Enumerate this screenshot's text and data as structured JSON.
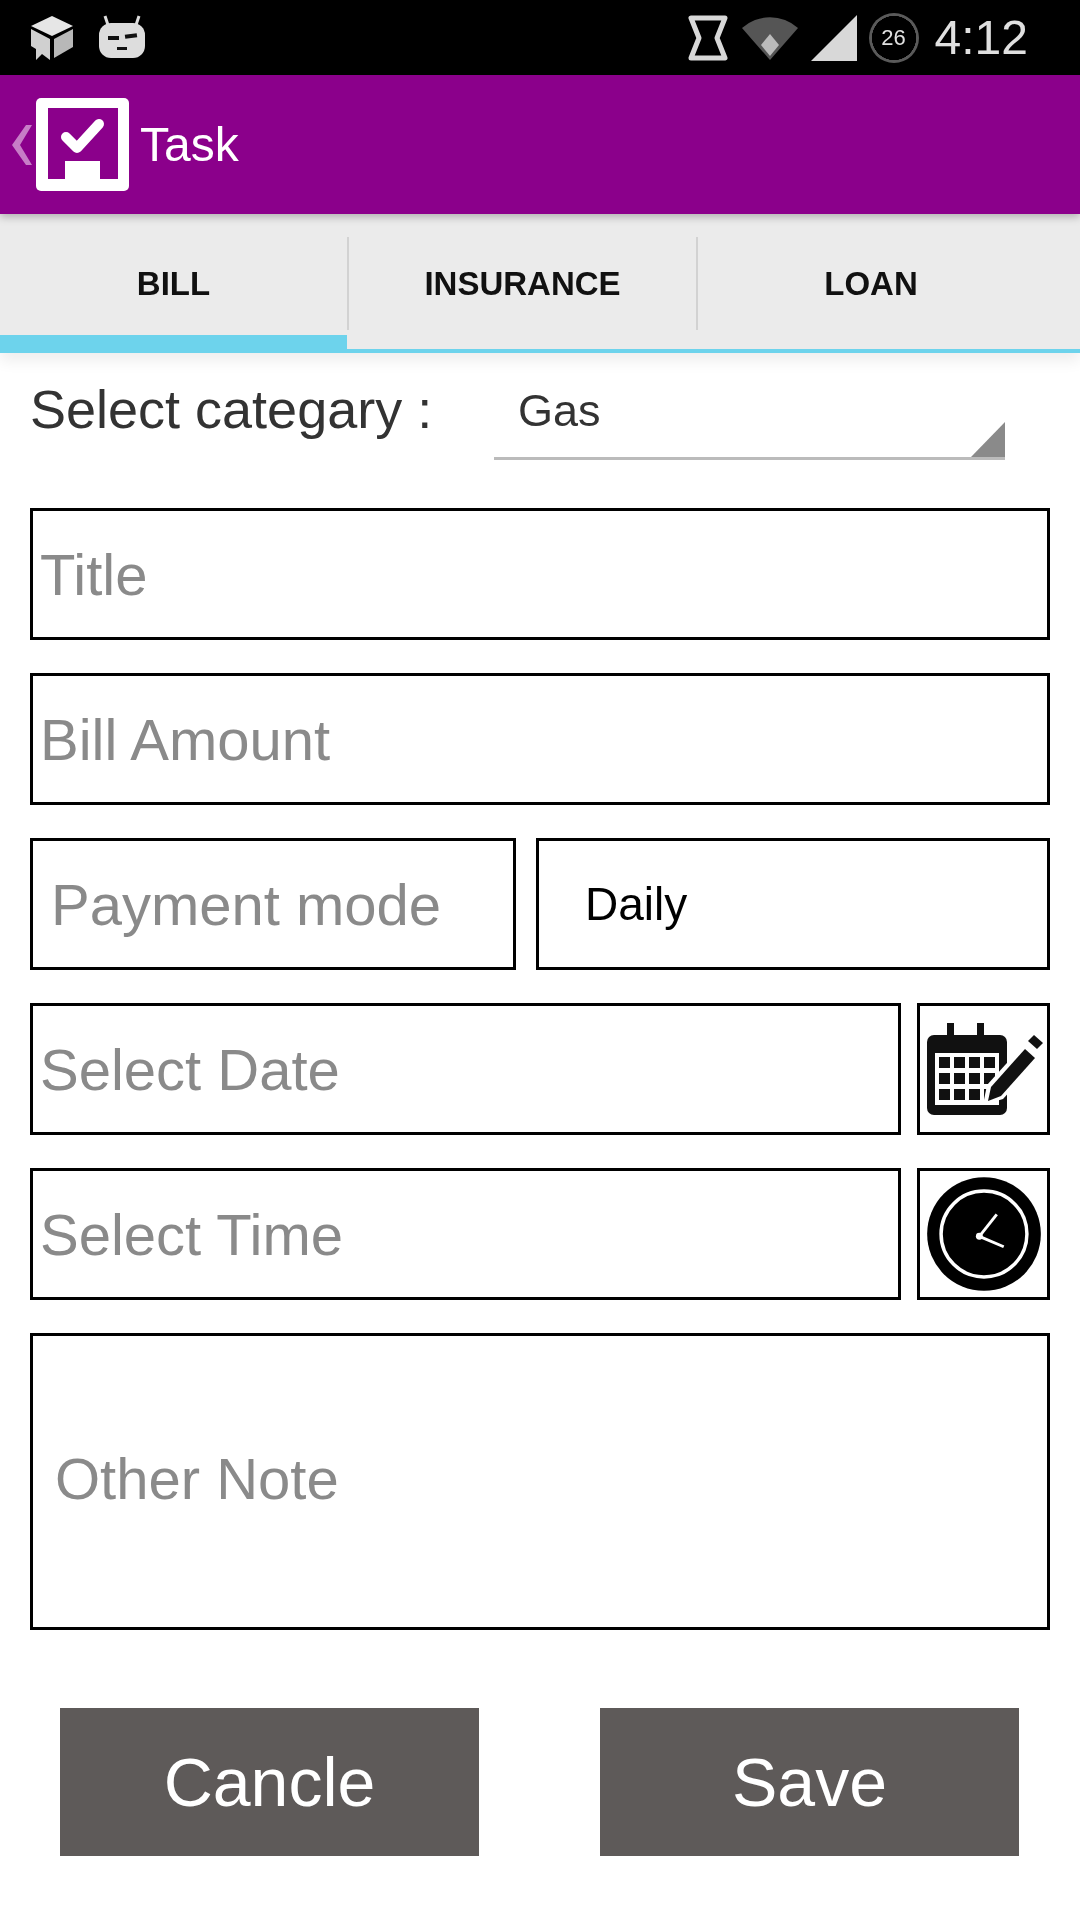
{
  "status_bar": {
    "battery": "26",
    "time": "4:12"
  },
  "app_bar": {
    "title": "Task"
  },
  "tabs": [
    {
      "label": "BILL",
      "selected": true
    },
    {
      "label": "INSURANCE",
      "selected": false
    },
    {
      "label": "LOAN",
      "selected": false
    }
  ],
  "category": {
    "label": "Select categary :",
    "value": "Gas"
  },
  "form": {
    "title": {
      "placeholder": "Title"
    },
    "bill_amount": {
      "placeholder": "Bill Amount"
    },
    "payment_mode": {
      "placeholder": "Payment mode"
    },
    "frequency": {
      "value": "Daily"
    },
    "date": {
      "placeholder": "Select Date"
    },
    "time": {
      "placeholder": "Select Time"
    },
    "note": {
      "placeholder": "Other Note"
    }
  },
  "buttons": [
    {
      "label": "Cancle"
    },
    {
      "label": "Save"
    }
  ]
}
